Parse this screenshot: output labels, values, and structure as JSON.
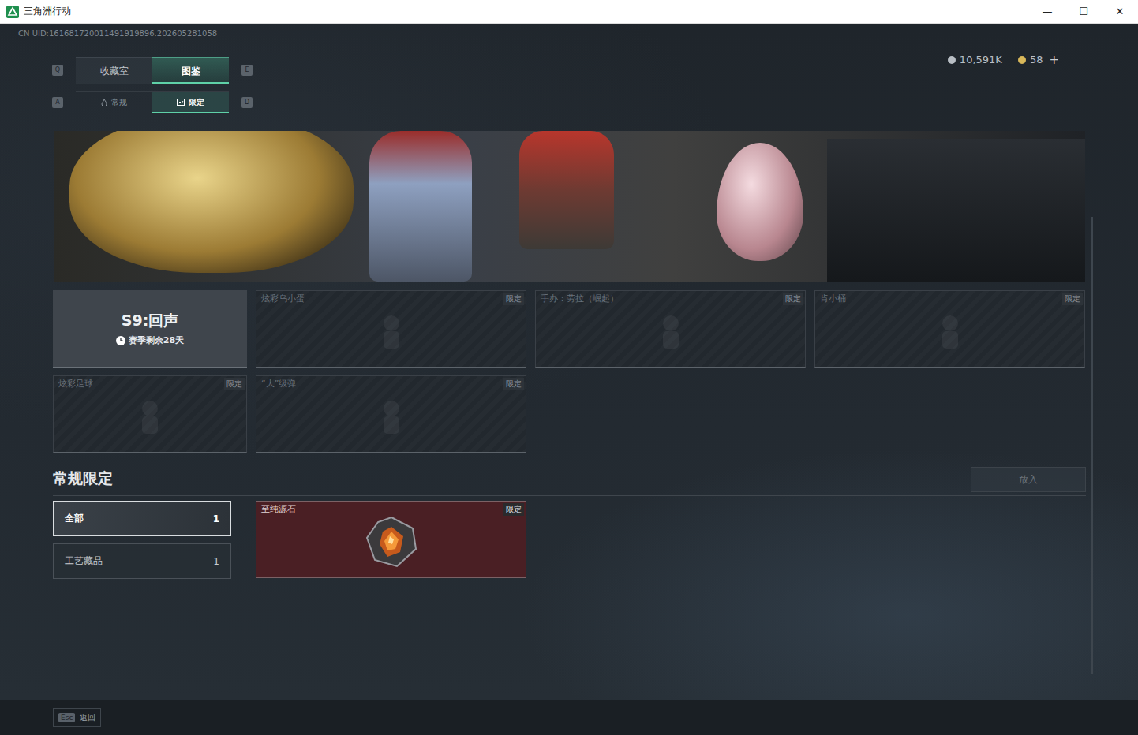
{
  "window": {
    "title": "三角洲行动",
    "controls": [
      "—",
      "☐",
      "✕"
    ]
  },
  "uid": "CN UID:161681720011491919896.202605281058",
  "nav_tabs": {
    "prev_key": "Q",
    "next_key": "E",
    "items": [
      {
        "label": "收藏室",
        "selected": false
      },
      {
        "label": "图鉴",
        "selected": true
      }
    ]
  },
  "sub_tabs": {
    "prev_key": "A",
    "next_key": "D",
    "items": [
      {
        "label": "常规",
        "selected": false
      },
      {
        "label": "限定",
        "selected": true
      }
    ]
  },
  "currency": [
    {
      "amount": "10,591K",
      "color": "#b8bec4"
    },
    {
      "amount": "58",
      "color": "#d9b85a"
    }
  ],
  "currency_add": "+",
  "season": {
    "title": "S9:回声",
    "remaining": "赛季剩余28天"
  },
  "season_items": [
    {
      "name": "炫彩乌小蛋",
      "badge": "限定",
      "collected": false
    },
    {
      "name": "手办：劳拉（崛起）",
      "badge": "限定",
      "collected": false
    },
    {
      "name": "肯小桶",
      "badge": "限定",
      "collected": false
    },
    {
      "name": "炫彩足球",
      "badge": "限定",
      "collected": false
    },
    {
      "name": "“大”级弹",
      "badge": "限定",
      "collected": false
    }
  ],
  "section": {
    "title": "常规限定",
    "action": {
      "label": "放入",
      "disabled": true
    }
  },
  "filters": [
    {
      "label": "全部",
      "count": "1",
      "selected": true
    },
    {
      "label": "工艺藏品",
      "count": "1",
      "selected": false
    }
  ],
  "items": [
    {
      "name": "至纯源石",
      "badge": "限定",
      "collected": true
    }
  ],
  "footer": {
    "key": "Esc",
    "label": "返回"
  }
}
